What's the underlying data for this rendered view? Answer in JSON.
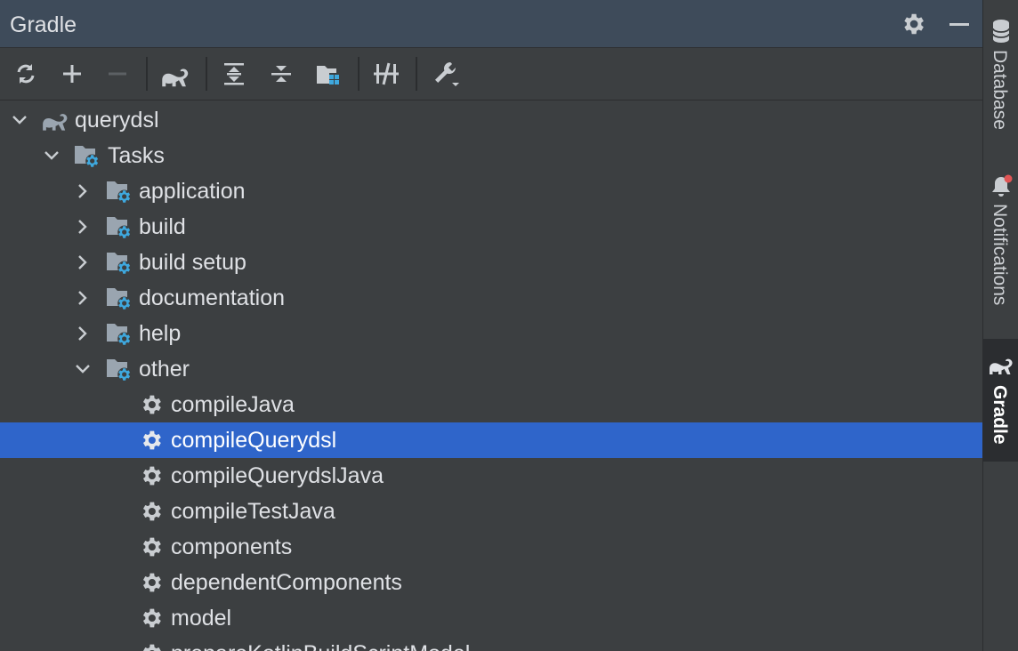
{
  "panel": {
    "title": "Gradle"
  },
  "header_buttons": [
    {
      "icon": "gear-icon",
      "label": "Settings"
    },
    {
      "icon": "minimize-icon",
      "label": "Hide"
    }
  ],
  "toolbar": {
    "buttons": [
      {
        "icon": "reload-icon"
      },
      {
        "icon": "plus-icon"
      },
      {
        "icon": "minus-icon",
        "disabled": true
      },
      {
        "icon": "elephant-icon"
      },
      {
        "icon": "expand-all-icon"
      },
      {
        "icon": "collapse-all-icon"
      },
      {
        "icon": "project-structure-icon"
      },
      {
        "icon": "toggle-offline-icon"
      },
      {
        "icon": "wrench-dropdown-icon"
      }
    ]
  },
  "tree": {
    "items": [
      {
        "label": "querydsl",
        "type": "project",
        "expanded": true,
        "level": 0
      },
      {
        "label": "Tasks",
        "type": "folder",
        "expanded": true,
        "level": 1
      },
      {
        "label": "application",
        "type": "folder",
        "expanded": false,
        "level": 2
      },
      {
        "label": "build",
        "type": "folder",
        "expanded": false,
        "level": 2
      },
      {
        "label": "build setup",
        "type": "folder",
        "expanded": false,
        "level": 2
      },
      {
        "label": "documentation",
        "type": "folder",
        "expanded": false,
        "level": 2
      },
      {
        "label": "help",
        "type": "folder",
        "expanded": false,
        "level": 2
      },
      {
        "label": "other",
        "type": "folder",
        "expanded": true,
        "level": 2
      },
      {
        "label": "compileJava",
        "type": "task",
        "level": 3
      },
      {
        "label": "compileQuerydsl",
        "type": "task",
        "level": 3,
        "selected": true
      },
      {
        "label": "compileQuerydslJava",
        "type": "task",
        "level": 3
      },
      {
        "label": "compileTestJava",
        "type": "task",
        "level": 3
      },
      {
        "label": "components",
        "type": "task",
        "level": 3
      },
      {
        "label": "dependentComponents",
        "type": "task",
        "level": 3
      },
      {
        "label": "model",
        "type": "task",
        "level": 3
      },
      {
        "label": "prepareKotlinBuildScriptModel",
        "type": "task",
        "level": 3
      }
    ]
  },
  "side_stripe": {
    "tabs": [
      {
        "label": "Database",
        "icon": "database-icon",
        "active": false
      },
      {
        "label": "Notifications",
        "icon": "bell-icon",
        "active": false,
        "badge": true
      },
      {
        "label": "Gradle",
        "icon": "elephant-icon",
        "active": true
      }
    ]
  },
  "colors": {
    "selection": "#2f65ca",
    "gear_accent": "#3ea8de",
    "badge": "#e05555"
  }
}
